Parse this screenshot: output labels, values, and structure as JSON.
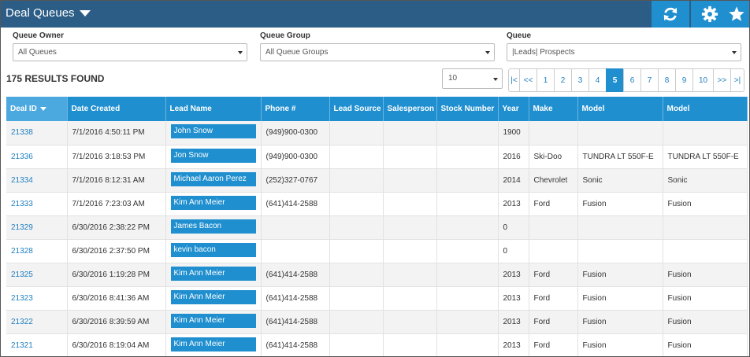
{
  "header": {
    "title": "Deal Queues",
    "buttons": [
      {
        "name": "refresh-icon"
      },
      {
        "name": "gear-icon"
      },
      {
        "name": "star-icon"
      }
    ],
    "bg_color": "#2c5d86",
    "accent_color": "#1f8fcf"
  },
  "filters": {
    "queue_owner": {
      "label": "Queue Owner",
      "value": "All Queues"
    },
    "queue_group": {
      "label": "Queue Group",
      "value": "All Queue Groups"
    },
    "queue": {
      "label": "Queue",
      "value": "|Leads| Prospects"
    }
  },
  "results_text": "175 RESULTS FOUND",
  "page_size": "10",
  "pagination": {
    "items": [
      "|<",
      "<<",
      "1",
      "2",
      "3",
      "4",
      "5",
      "6",
      "7",
      "8",
      "9",
      "10",
      ">>",
      ">|"
    ],
    "active": "5"
  },
  "table": {
    "columns": [
      "Deal ID",
      "Date Created",
      "Lead Name",
      "Phone #",
      "Lead Source",
      "Salesperson",
      "Stock Number",
      "Year",
      "Make",
      "Model",
      "Model"
    ],
    "sorted_column": "Deal ID",
    "rows": [
      {
        "id": "21338",
        "date": "7/1/2016 4:50:11 PM",
        "lead": "John Snow",
        "phone": "(949)900-0300",
        "source": "",
        "salesperson": "",
        "stock": "",
        "year": "1900",
        "make": "",
        "model": "",
        "model2": ""
      },
      {
        "id": "21336",
        "date": "7/1/2016 3:18:53 PM",
        "lead": "Jon Snow",
        "phone": "(949)900-0300",
        "source": "",
        "salesperson": "",
        "stock": "",
        "year": "2016",
        "make": "Ski-Doo",
        "model": "TUNDRA LT 550F-E",
        "model2": "TUNDRA LT 550F-E"
      },
      {
        "id": "21334",
        "date": "7/1/2016 8:12:31 AM",
        "lead": "Michael Aaron Perez",
        "phone": "(252)327-0767",
        "source": "",
        "salesperson": "",
        "stock": "",
        "year": "2014",
        "make": "Chevrolet",
        "model": "Sonic",
        "model2": "Sonic"
      },
      {
        "id": "21333",
        "date": "7/1/2016 7:23:03 AM",
        "lead": "Kim Ann Meier",
        "phone": "(641)414-2588",
        "source": "",
        "salesperson": "",
        "stock": "",
        "year": "2013",
        "make": "Ford",
        "model": "Fusion",
        "model2": "Fusion"
      },
      {
        "id": "21329",
        "date": "6/30/2016 2:38:22 PM",
        "lead": "James Bacon",
        "phone": "",
        "source": "",
        "salesperson": "",
        "stock": "",
        "year": "0",
        "make": "",
        "model": "",
        "model2": ""
      },
      {
        "id": "21328",
        "date": "6/30/2016 2:37:50 PM",
        "lead": "kevin bacon",
        "phone": "",
        "source": "",
        "salesperson": "",
        "stock": "",
        "year": "0",
        "make": "",
        "model": "",
        "model2": ""
      },
      {
        "id": "21325",
        "date": "6/30/2016 1:19:28 PM",
        "lead": "Kim Ann Meier",
        "phone": "(641)414-2588",
        "source": "",
        "salesperson": "",
        "stock": "",
        "year": "2013",
        "make": "Ford",
        "model": "Fusion",
        "model2": "Fusion"
      },
      {
        "id": "21323",
        "date": "6/30/2016 8:41:36 AM",
        "lead": "Kim Ann Meier",
        "phone": "(641)414-2588",
        "source": "",
        "salesperson": "",
        "stock": "",
        "year": "2013",
        "make": "Ford",
        "model": "Fusion",
        "model2": "Fusion"
      },
      {
        "id": "21322",
        "date": "6/30/2016 8:39:59 AM",
        "lead": "Kim Ann Meier",
        "phone": "(641)414-2588",
        "source": "",
        "salesperson": "",
        "stock": "",
        "year": "2013",
        "make": "Ford",
        "model": "Fusion",
        "model2": "Fusion"
      },
      {
        "id": "21321",
        "date": "6/30/2016 8:19:04 AM",
        "lead": "Kim Ann Meier",
        "phone": "(641)414-2588",
        "source": "",
        "salesperson": "",
        "stock": "",
        "year": "2013",
        "make": "Ford",
        "model": "Fusion",
        "model2": "Fusion"
      }
    ]
  }
}
